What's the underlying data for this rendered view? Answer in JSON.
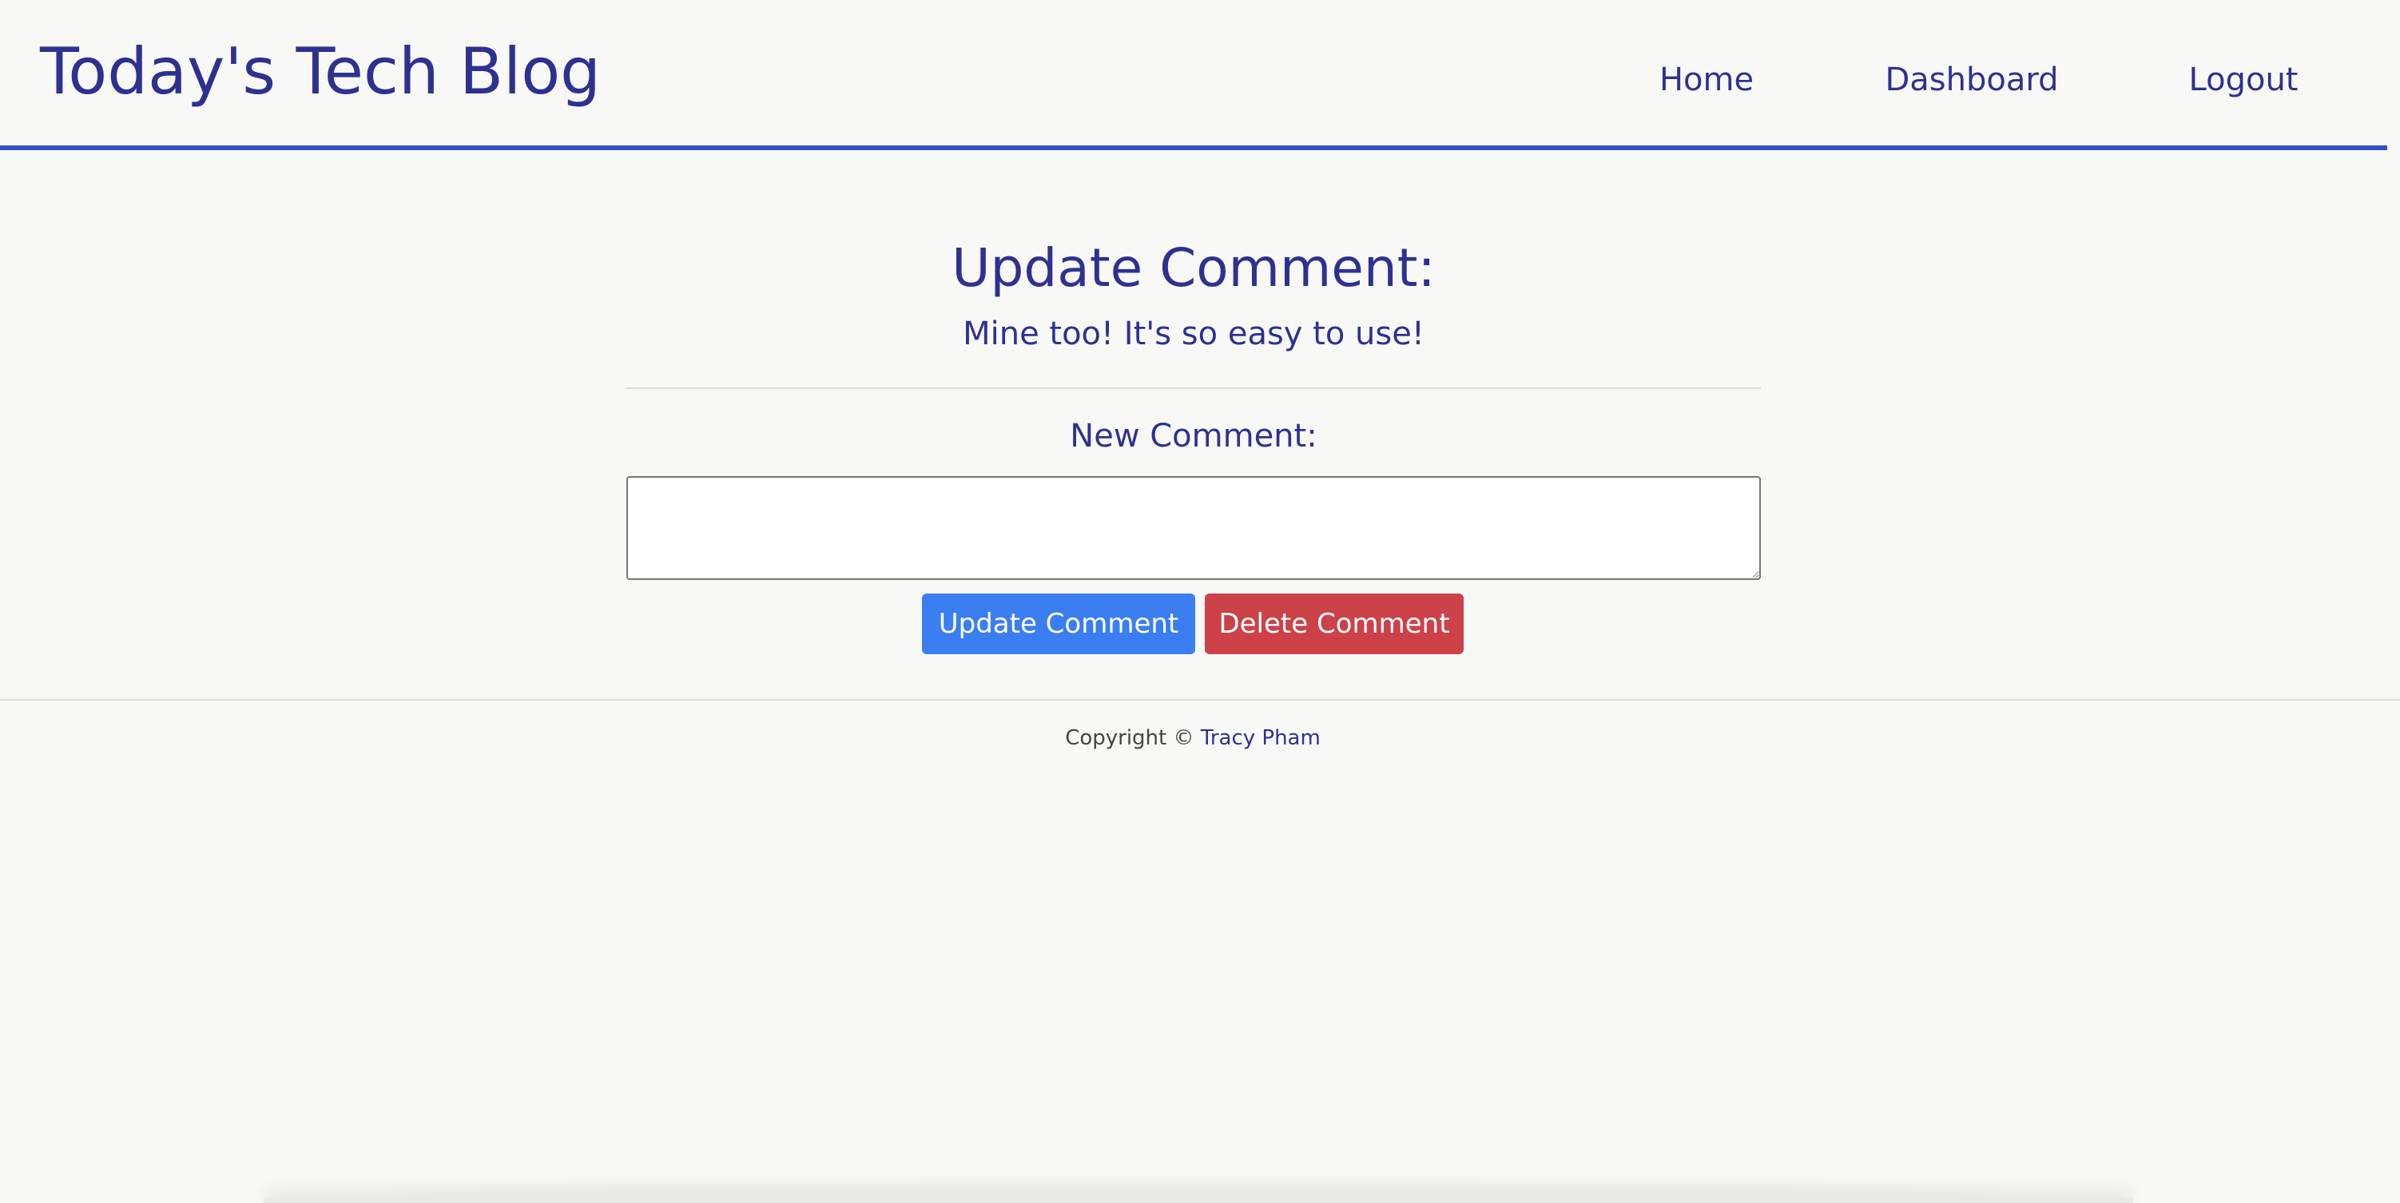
{
  "header": {
    "site_title": "Today's Tech Blog",
    "nav": {
      "home": "Home",
      "dashboard": "Dashboard",
      "logout": "Logout"
    }
  },
  "main": {
    "heading": "Update Comment:",
    "current_comment": "Mine too! It's so easy to use!",
    "new_comment_label": "New Comment:",
    "new_comment_value": "",
    "update_button_label": "Update Comment",
    "delete_button_label": "Delete Comment"
  },
  "footer": {
    "copyright_prefix": "Copyright © ",
    "author_name": "Tracy Pham"
  },
  "colors": {
    "brand_text": "#2e3192",
    "header_rule": "#3053c4",
    "update_button": "#3a7ef2",
    "delete_button": "#cd4149",
    "page_background": "#f8f9f7"
  }
}
